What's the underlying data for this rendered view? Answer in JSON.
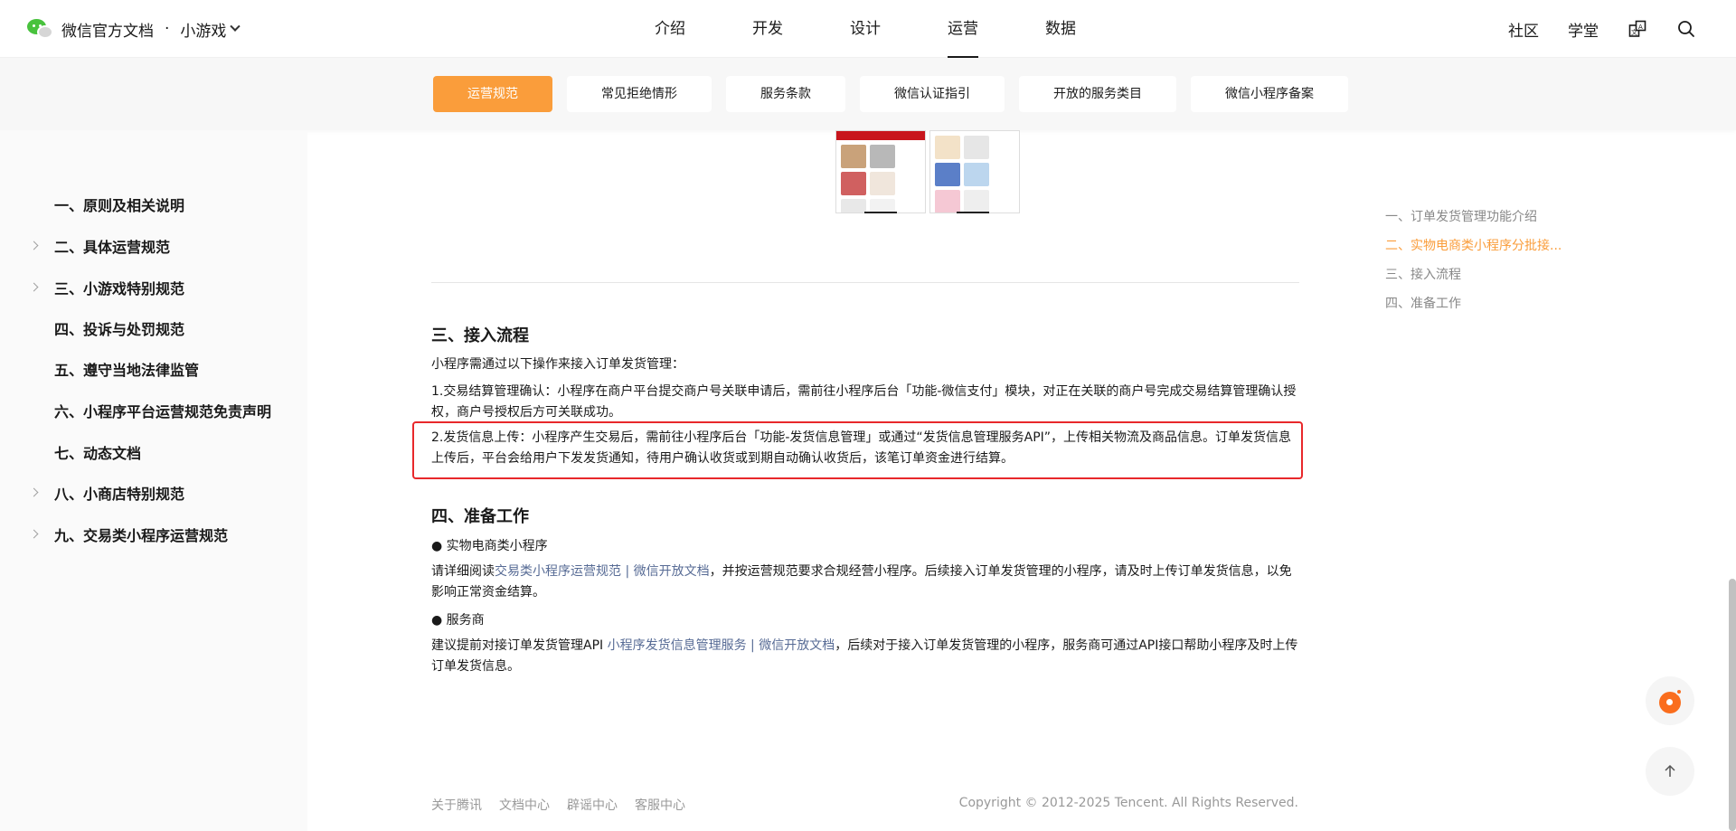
{
  "header": {
    "brand_title": "微信官方文档",
    "brand_separator": "·",
    "brand_section": "小游戏",
    "nav": [
      {
        "label": "介绍",
        "active": false
      },
      {
        "label": "开发",
        "active": false
      },
      {
        "label": "设计",
        "active": false
      },
      {
        "label": "运营",
        "active": true
      },
      {
        "label": "数据",
        "active": false
      }
    ],
    "right_links": [
      "社区",
      "学堂"
    ],
    "icons": [
      "translate-icon",
      "search-icon"
    ]
  },
  "subtabs": [
    {
      "label": "运营规范",
      "active": true
    },
    {
      "label": "常见拒绝情形",
      "active": false
    },
    {
      "label": "服务条款",
      "active": false
    },
    {
      "label": "微信认证指引",
      "active": false
    },
    {
      "label": "开放的服务类目",
      "active": false
    },
    {
      "label": "微信小程序备案",
      "active": false
    }
  ],
  "sidebar": {
    "items": [
      {
        "label": "一、原则及相关说明",
        "expandable": false
      },
      {
        "label": "二、具体运营规范",
        "expandable": true
      },
      {
        "label": "三、小游戏特别规范",
        "expandable": true
      },
      {
        "label": "四、投诉与处罚规范",
        "expandable": false
      },
      {
        "label": "五、遵守当地法律监管",
        "expandable": false
      },
      {
        "label": "六、小程序平台运营规范免责声明",
        "expandable": false
      },
      {
        "label": "七、动态文档",
        "expandable": false
      },
      {
        "label": "八、小商店特别规范",
        "expandable": true
      },
      {
        "label": "九、交易类小程序运营规范",
        "expandable": true
      }
    ]
  },
  "content": {
    "partial_text": "实物电商类小程序",
    "section3": {
      "title": "三、接入流程",
      "intro": "小程序需通过以下操作来接入订单发货管理：",
      "step1": "1.交易结算管理确认：小程序在商户平台提交商户号关联申请后，需前往小程序后台「功能-微信支付」模块，对正在关联的商户号完成交易结算管理确认授权，商户号授权后方可关联成功。",
      "step2": "2.发货信息上传：小程序产生交易后，需前往小程序后台「功能-发货信息管理」或通过“发货信息管理服务API”，上传相关物流及商品信息。订单发货信息上传后，平台会给用户下发发货通知，待用户确认收货或到期自动确认收货后，该笔订单资金进行结算。"
    },
    "section4": {
      "title": "四、准备工作",
      "bullet1": "● 实物电商类小程序",
      "p1_before": "请详细阅读",
      "p1_link": "交易类小程序运营规范 | 微信开放文档",
      "p1_after": "，并按运营规范要求合规经营小程序。后续接入订单发货管理的小程序，请及时上传订单发货信息，以免影响正常资金结算。",
      "bullet2": "● 服务商",
      "p2_before": "建议提前对接订单发货管理API ",
      "p2_link": "小程序发货信息管理服务 | 微信开放文档",
      "p2_after": "，后续对于接入订单发货管理的小程序，服务商可通过API接口帮助小程序及时上传订单发货信息。"
    }
  },
  "toc": [
    {
      "label": "一、订单发货管理功能介绍",
      "active": false
    },
    {
      "label": "二、实物电商类小程序分批接...",
      "active": true
    },
    {
      "label": "三、接入流程",
      "active": false
    },
    {
      "label": "四、准备工作",
      "active": false
    }
  ],
  "footer": {
    "links": [
      "关于腾讯",
      "文档中心",
      "辟谣中心",
      "客服中心"
    ],
    "copyright": "Copyright © 2012-2025 Tencent. All Rights Reserved."
  },
  "colors": {
    "accent": "#fa9d3b",
    "link": "#576b95",
    "highlight": "#e8282b"
  }
}
